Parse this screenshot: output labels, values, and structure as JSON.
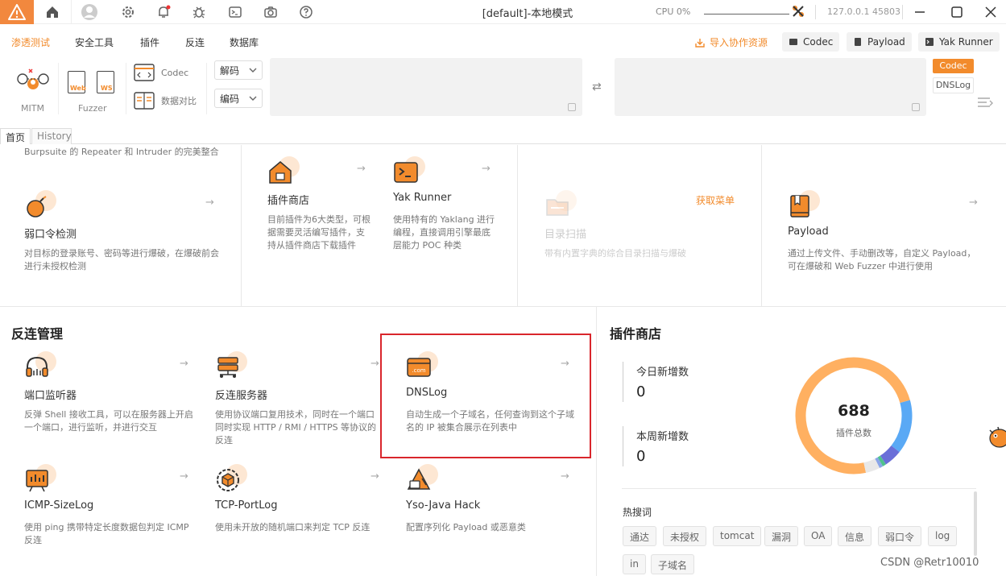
{
  "titlebar": {
    "title": "[default]-本地模式",
    "cpu": "CPU 0%",
    "address": "127.0.0.1 45803",
    "icons": [
      "home-icon",
      "user-icon",
      "gear-icon",
      "bell-icon",
      "bug-icon",
      "terminal-icon",
      "camera-icon",
      "help-icon"
    ]
  },
  "menu": {
    "items": [
      "渗透测试",
      "安全工具",
      "插件",
      "反连",
      "数据库"
    ],
    "import_label": "导入协作资源",
    "codec_btn": "Codec",
    "payload_btn": "Payload",
    "yakrunner_btn": "Yak Runner"
  },
  "toolbar": {
    "mitm": "MITM",
    "fuzzer": "Fuzzer",
    "web": "Web",
    "ws": "WS",
    "codec": "Codec",
    "compare": "数据对比",
    "decode": "解码",
    "encode": "编码",
    "codec_tag": "Codec",
    "dnslog_tag": "DNSLog"
  },
  "tabs": [
    "首页",
    "History"
  ],
  "top_cards": {
    "burp_desc": "Burpsuite 的 Repeater 和 Intruder 的完美整合",
    "weakpass": {
      "title": "弱口令检测",
      "desc": "对目标的登录账号、密码等进行爆破，在爆破前会进行未授权检测"
    },
    "plugin_store": {
      "title": "插件商店",
      "desc": "目前插件为6大类型，可根据需要灵活编写插件，支持从插件商店下载插件"
    },
    "yak_runner": {
      "title": "Yak Runner",
      "desc": "使用特有的 Yaklang 进行编程，直接调用引擎最底层能力 POC 种类"
    },
    "dir_scan": {
      "title": "目录扫描",
      "desc": "带有内置字典的综合目录扫描与爆破",
      "badge": "获取菜单"
    },
    "payload": {
      "title": "Payload",
      "desc": "通过上传文件、手动删改等，自定义 Payload，可在爆破和 Web Fuzzer 中进行使用"
    }
  },
  "reverse": {
    "section_title": "反连管理",
    "cards": [
      {
        "title": "端口监听器",
        "desc": "反弹 Shell 接收工具，可以在服务器上开启一个端口，进行监听，并进行交互"
      },
      {
        "title": "反连服务器",
        "desc": "使用协议端口复用技术，同时在一个端口同时实现 HTTP / RMI / HTTPS 等协议的反连"
      },
      {
        "title": "DNSLog",
        "desc": "自动生成一个子域名，任何查询到这个子域名的 IP 被集合展示在列表中",
        "icon_text": ".com"
      },
      {
        "title": "ICMP-SizeLog",
        "desc": "使用 ping 携带特定长度数据包判定 ICMP 反连"
      },
      {
        "title": "TCP-PortLog",
        "desc": "使用未开放的随机端口来判定 TCP 反连"
      },
      {
        "title": "Yso-Java Hack",
        "desc": "配置序列化 Payload 或恶意类"
      }
    ]
  },
  "store": {
    "section_title": "插件商店",
    "today_label": "今日新增数",
    "today_value": "0",
    "week_label": "本周新增数",
    "week_value": "0",
    "total": "688",
    "total_label": "插件总数",
    "hot_label": "热搜词",
    "keywords": [
      "通达",
      "未授权",
      "tomcat",
      "漏洞",
      "OA",
      "信息",
      "弱口令",
      "log",
      "in",
      "子域名"
    ],
    "donut": [
      {
        "color": "#ffb061",
        "value": 0.74
      },
      {
        "color": "#5aa9f5",
        "value": 0.15
      },
      {
        "color": "#6a6fd8",
        "value": 0.05
      },
      {
        "color": "#4fc28e",
        "value": 0.01
      },
      {
        "color": "#8aa5e8",
        "value": 0.01
      },
      {
        "color": "#e8e8e8",
        "value": 0.04
      }
    ]
  },
  "watermark": "CSDN @Retr10010"
}
